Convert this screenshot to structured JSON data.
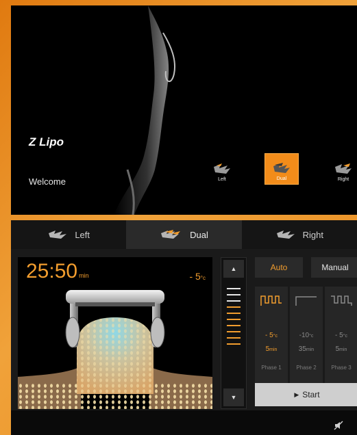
{
  "welcome": {
    "brand": "Z Lipo",
    "greeting": "Welcome",
    "modes": [
      {
        "label": "Left",
        "active": false
      },
      {
        "label": "Dual",
        "active": true
      },
      {
        "label": "Right",
        "active": false
      }
    ]
  },
  "panel": {
    "tabs": [
      {
        "label": "Left",
        "active": false
      },
      {
        "label": "Dual",
        "active": true
      },
      {
        "label": "Right",
        "active": false
      }
    ],
    "timer": {
      "value": "25:50",
      "unit": "min"
    },
    "temperature": {
      "value": "- 5",
      "unit": "°c"
    },
    "level": {
      "total": 10,
      "active": 7
    },
    "mode_toggle": {
      "auto": "Auto",
      "manual": "Manual",
      "selected": "Auto"
    },
    "phases": [
      {
        "temp": "- 5",
        "temp_unit": "°c",
        "time": "5",
        "time_unit": "min",
        "label": "Phase 1",
        "active": true
      },
      {
        "temp": "-10",
        "temp_unit": "°c",
        "time": "35",
        "time_unit": "min",
        "label": "Phase 2",
        "active": false
      },
      {
        "temp": "- 5",
        "temp_unit": "°c",
        "time": "5",
        "time_unit": "min",
        "label": "Phase 3",
        "active": false
      }
    ],
    "start_label": "Start",
    "colors": {
      "accent": "#f29d2e",
      "inactive": "#8a8a8a"
    }
  }
}
